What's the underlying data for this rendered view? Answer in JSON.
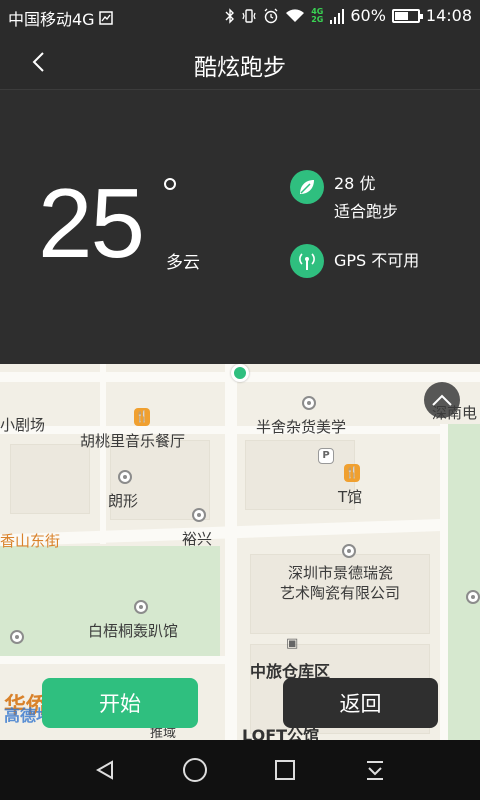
{
  "status_bar": {
    "carrier": "中国移动4G",
    "network_top": "4G",
    "network_bottom": "2G",
    "battery": "60%",
    "battery_level": 0.6,
    "time": "14:08"
  },
  "header": {
    "title": "酷炫跑步"
  },
  "weather": {
    "temperature": "25",
    "condition": "多云",
    "air_quality": "28 优",
    "advice": "适合跑步",
    "gps_status": "GPS 不可用"
  },
  "map": {
    "labels": {
      "theater": "小剧场",
      "north_road": "深南电",
      "walnut_restaurant": "胡桃里音乐餐厅",
      "banshe_store": "半舍杂货美学",
      "langxing": "朗形",
      "t_hall": "T馆",
      "xiangshan_east_st": "香山东街",
      "yuxing": "裕兴",
      "jingdezhen_porcelain_1": "深圳市景德瑞瓷",
      "jingdezhen_porcelain_2": "艺术陶瓷有限公司",
      "baiwutong": "白梧桐轰趴馆",
      "zhonglu_warehouse": "中旅仓库区",
      "loft": "LOFT公馆",
      "watershed": "推域",
      "bottom_left_text": "华侨城",
      "amap": "高德地图"
    }
  },
  "buttons": {
    "start": "开始",
    "back": "返回"
  },
  "colors": {
    "accent": "#2fbf7f",
    "background": "#2b2b2b"
  }
}
